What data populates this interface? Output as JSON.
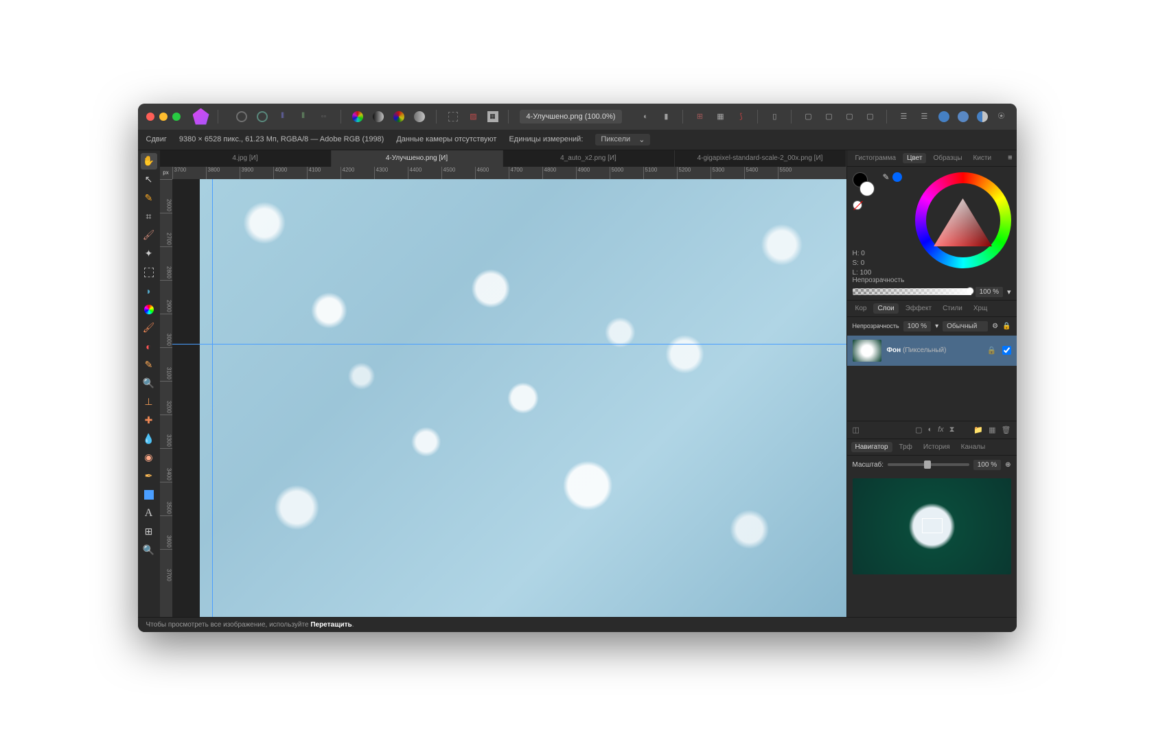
{
  "titlebar": {
    "filename": "4-Улучшено.png (100.0%)"
  },
  "infobar": {
    "shift": "Сдвиг",
    "dimensions": "9380 × 6528 пикс., 61.23 Мп, RGBA/8 — Adobe RGB (1998)",
    "camera": "Данные камеры отсутствуют",
    "units_label": "Единицы измерений:",
    "units_value": "Пиксели"
  },
  "tabs": [
    {
      "label": "4.jpg [И]"
    },
    {
      "label": "4-Улучшено.png [И]"
    },
    {
      "label": "4_auto_x2.png [И]"
    },
    {
      "label": "4-gigapixel-standard-scale-2_00x.png [И]"
    }
  ],
  "ruler_unit": "px",
  "ruler_h": [
    "3700",
    "3800",
    "3900",
    "4000",
    "4100",
    "4200",
    "4300",
    "4400",
    "4500",
    "4600",
    "4700",
    "4800",
    "4900",
    "5000",
    "5100",
    "5200",
    "5300",
    "5400",
    "5500"
  ],
  "ruler_v": [
    "2600",
    "2700",
    "2800",
    "2900",
    "3000",
    "3100",
    "3200",
    "3300",
    "3400",
    "3500",
    "3600",
    "3700"
  ],
  "panels": {
    "top_tabs": [
      "Гистограмма",
      "Цвет",
      "Образцы",
      "Кисти"
    ],
    "top_active": 1,
    "hsl": {
      "h": "H: 0",
      "s": "S: 0",
      "l": "L: 100"
    },
    "opacity_label": "Непрозрачность",
    "opacity_value": "100 %",
    "mid_tabs": [
      "Кор",
      "Слои",
      "Эффект",
      "Стили",
      "Хрщ"
    ],
    "mid_active": 1,
    "layer_opacity_label": "Непрозрачность",
    "layer_opacity_value": "100 %",
    "blend_mode": "Обычный",
    "layer_name_bold": "Фон",
    "layer_name_type": "(Пиксельный)",
    "nav_tabs": [
      "Навигатор",
      "Трф",
      "История",
      "Каналы"
    ],
    "nav_active": 0,
    "zoom_label": "Масштаб:",
    "zoom_value": "100 %"
  },
  "status": {
    "prefix": "Чтобы просмотреть все изображение, используйте ",
    "bold": "Перетащить",
    "suffix": "."
  }
}
